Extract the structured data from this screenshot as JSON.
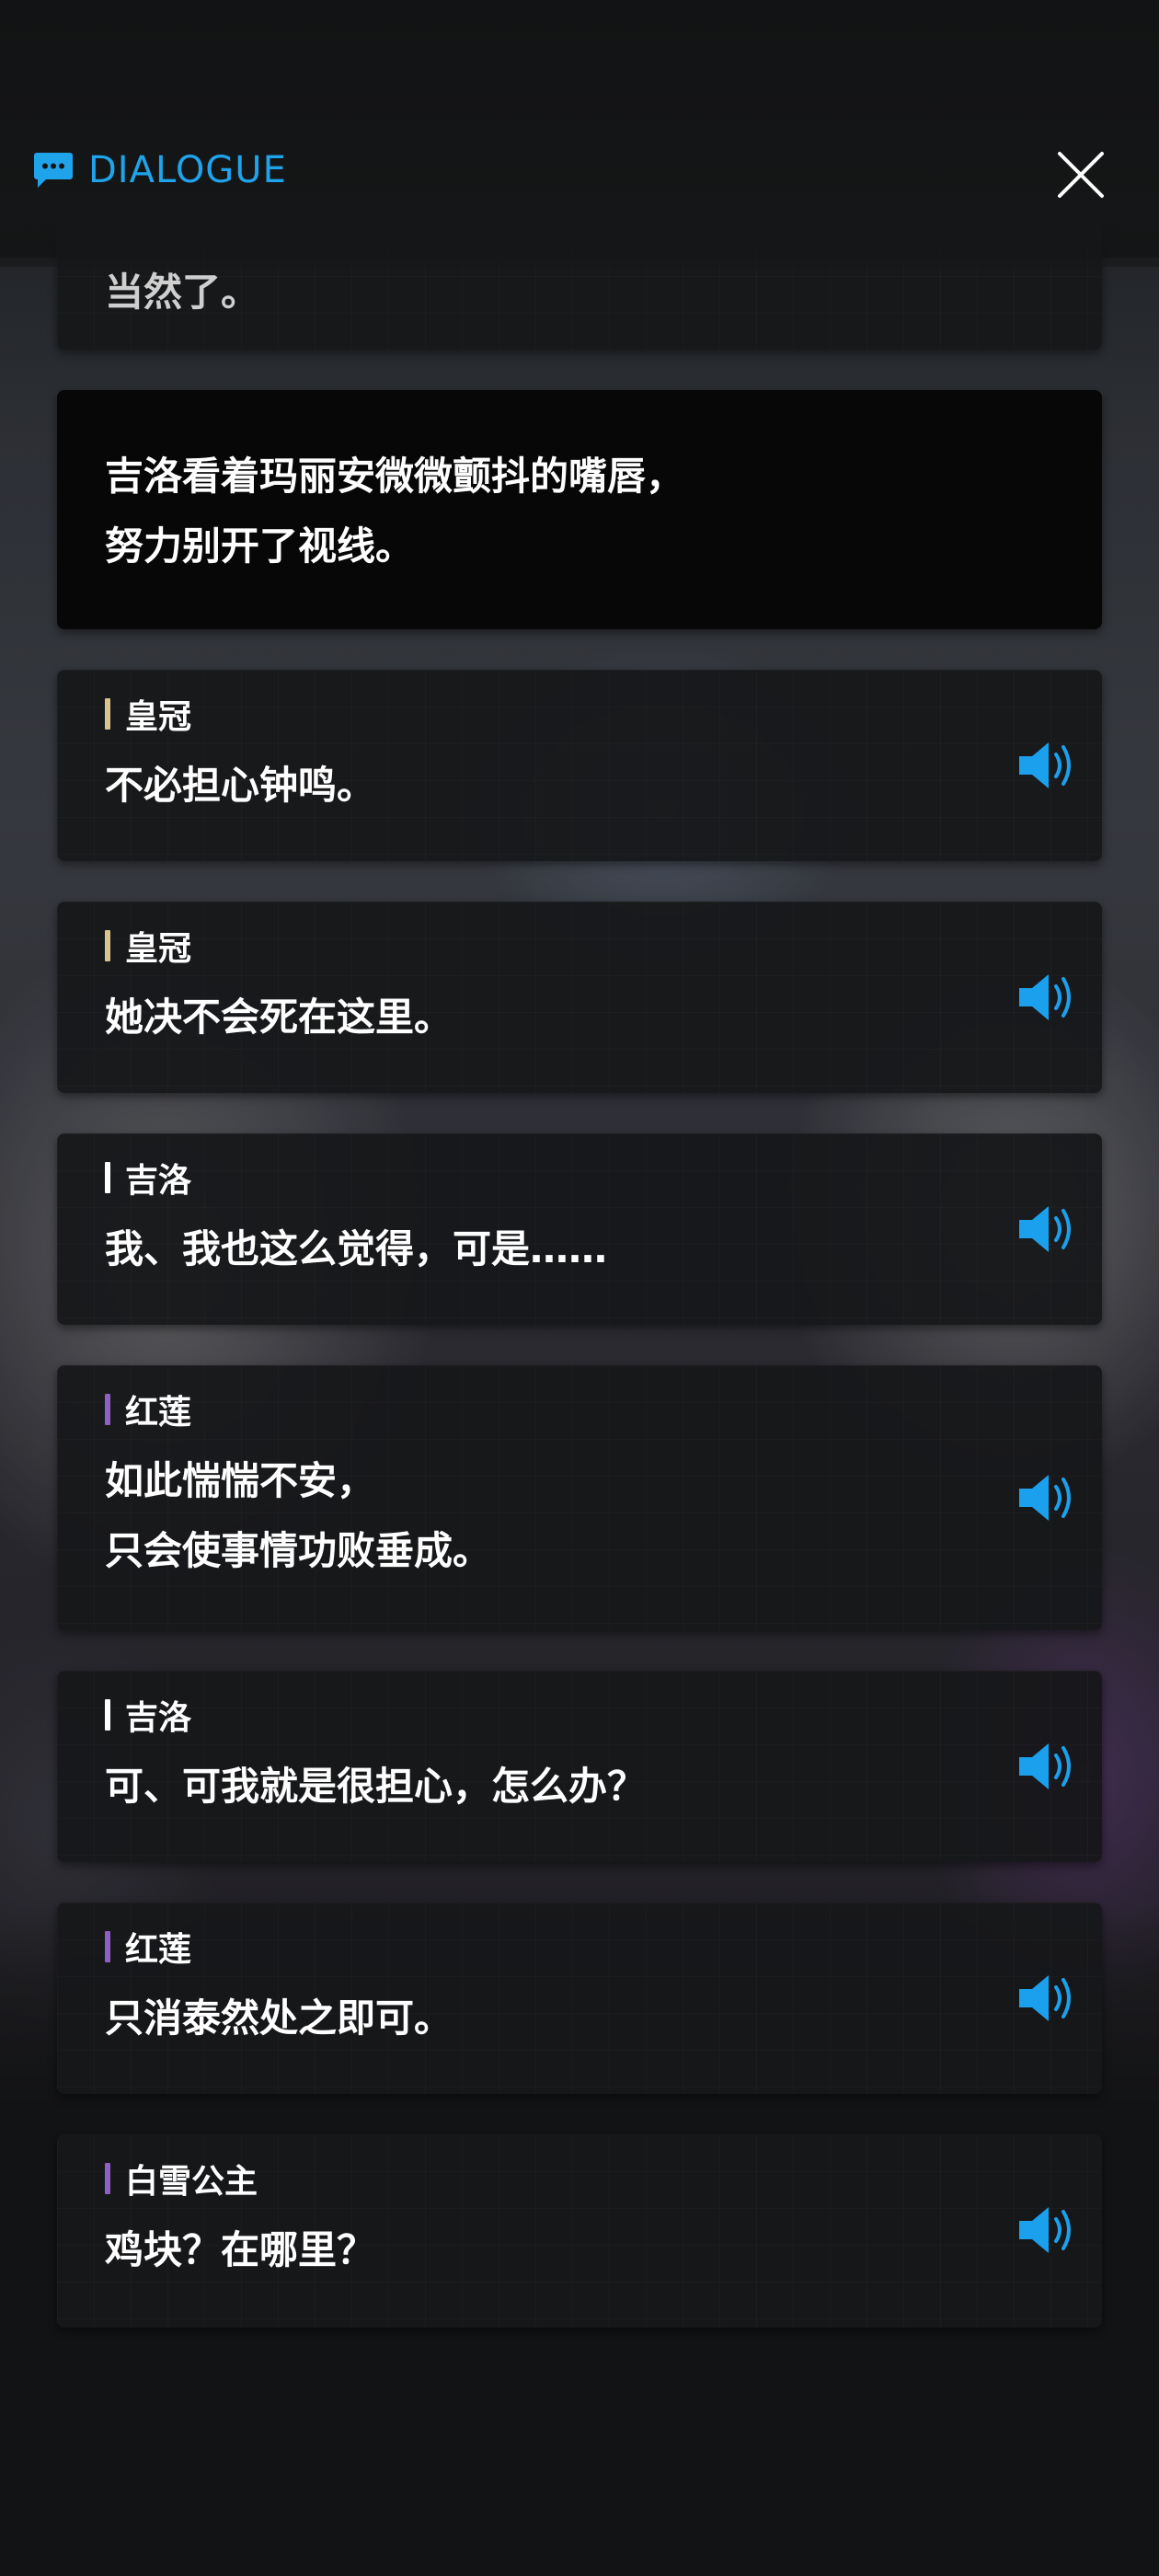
{
  "header": {
    "title": "DIALOGUE",
    "title_color": "#1fa3ea",
    "icon": "chat-bubble-icon",
    "close_icon": "close-icon"
  },
  "partial_card": {
    "text": "当然了。"
  },
  "narration": {
    "text": "吉洛看着玛丽安微微颤抖的嘴唇，\n努力别开了视线。"
  },
  "voice_icon": "speaker-volume-icon",
  "voice_color": "#1aa0ec",
  "lines": [
    {
      "speaker": "皇冠",
      "bar_color": "#d8c48c",
      "text": "不必担心钟鸣。"
    },
    {
      "speaker": "皇冠",
      "bar_color": "#d8c48c",
      "text": "她决不会死在这里。"
    },
    {
      "speaker": "吉洛",
      "bar_color": "#ffffff",
      "text": "我、我也这么觉得，可是……"
    },
    {
      "speaker": "红莲",
      "bar_color": "#8f5fc4",
      "text": "如此惴惴不安，\n只会使事情功败垂成。"
    },
    {
      "speaker": "吉洛",
      "bar_color": "#ffffff",
      "text": "可、可我就是很担心，怎么办？"
    },
    {
      "speaker": "红莲",
      "bar_color": "#8f5fc4",
      "text": "只消泰然处之即可。"
    },
    {
      "speaker": "白雪公主",
      "bar_color": "#8f5fc4",
      "text": "鸡块？在哪里？"
    }
  ]
}
